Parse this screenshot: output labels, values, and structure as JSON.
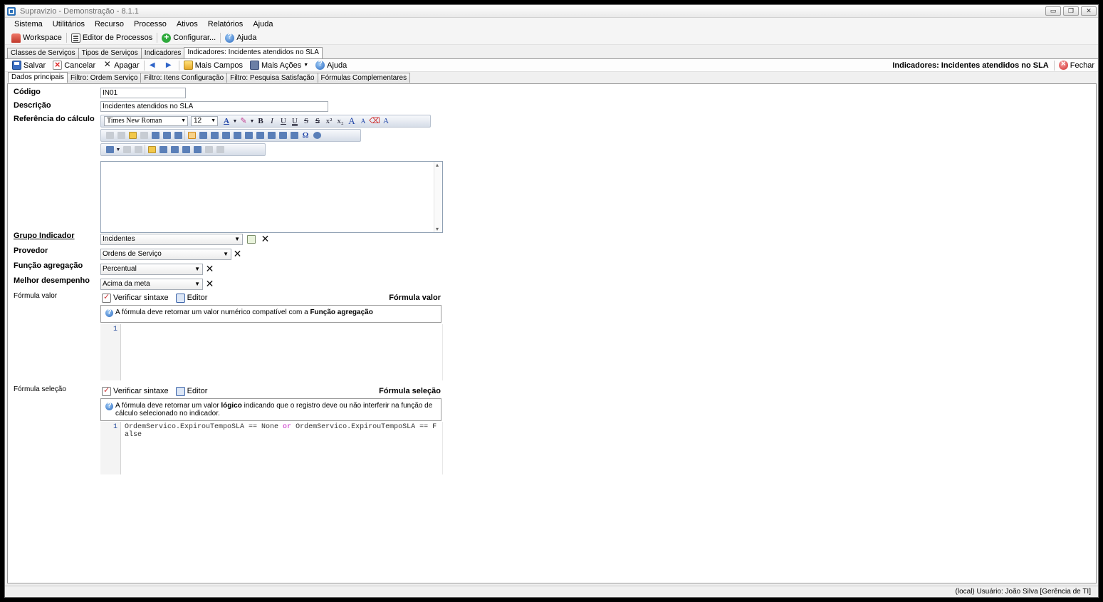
{
  "window": {
    "title": "Supravizio - Demonstração - 8.1.1",
    "btn_min": "▭",
    "btn_max": "❐",
    "btn_close": "✕"
  },
  "menu": [
    "Sistema",
    "Utilitários",
    "Recurso",
    "Processo",
    "Ativos",
    "Relatórios",
    "Ajuda"
  ],
  "toolbar": {
    "workspace": "Workspace",
    "editor_processos": "Editor de Processos",
    "configurar": "Configurar...",
    "ajuda": "Ajuda"
  },
  "doc_tabs": [
    "Classes de Serviços",
    "Tipos de Serviços",
    "Indicadores",
    "Indicadores: Incidentes atendidos no SLA"
  ],
  "actions": {
    "salvar": "Salvar",
    "cancelar": "Cancelar",
    "apagar": "Apagar",
    "mais_campos": "Mais Campos",
    "mais_acoes": "Mais Ações",
    "ajuda": "Ajuda",
    "record_title": "Indicadores: Incidentes atendidos no SLA",
    "fechar": "Fechar"
  },
  "inner_tabs": [
    "Dados principais",
    "Filtro: Ordem Serviço",
    "Filtro: Itens Configuração",
    "Filtro: Pesquisa Satisfação",
    "Fórmulas Complementares"
  ],
  "form": {
    "codigo_label": "Código",
    "codigo_value": "IN01",
    "descricao_label": "Descrição",
    "descricao_value": "Incidentes atendidos no SLA",
    "referencia_label": "Referência do cálculo",
    "rte_font": "Times New Roman",
    "rte_size": "12",
    "grupo_label": "Grupo Indicador",
    "grupo_value": "Incidentes",
    "provedor_label": "Provedor",
    "provedor_value": "Ordens de Serviço",
    "funcao_label": "Função agregação",
    "funcao_value": "Percentual",
    "melhor_label": "Melhor desempenho",
    "melhor_value": "Acima da meta"
  },
  "formula_valor": {
    "label": "Fórmula valor",
    "verificar": "Verificar sintaxe",
    "editor": "Editor",
    "title": "Fórmula valor",
    "info_prefix": "A fórmula deve retornar um valor numérico compatível com a ",
    "info_bold": "Função agregação",
    "line1": "1"
  },
  "formula_selecao": {
    "label": "Fórmula seleção",
    "verificar": "Verificar sintaxe",
    "editor": "Editor",
    "title": "Fórmula seleção",
    "info_prefix": "A fórmula deve retornar um valor ",
    "info_bold": "lógico",
    "info_suffix": " indicando que o registro deve ou não interferir na função de cálculo selecionado no indicador.",
    "line1": "1",
    "code_part1": "OrdemServico.ExpirouTempoSLA == None ",
    "code_kw": "or",
    "code_part2": " OrdemServico.ExpirouTempoSLA == False"
  },
  "status": "(local)  Usuário: João Silva [Gerência de TI]"
}
